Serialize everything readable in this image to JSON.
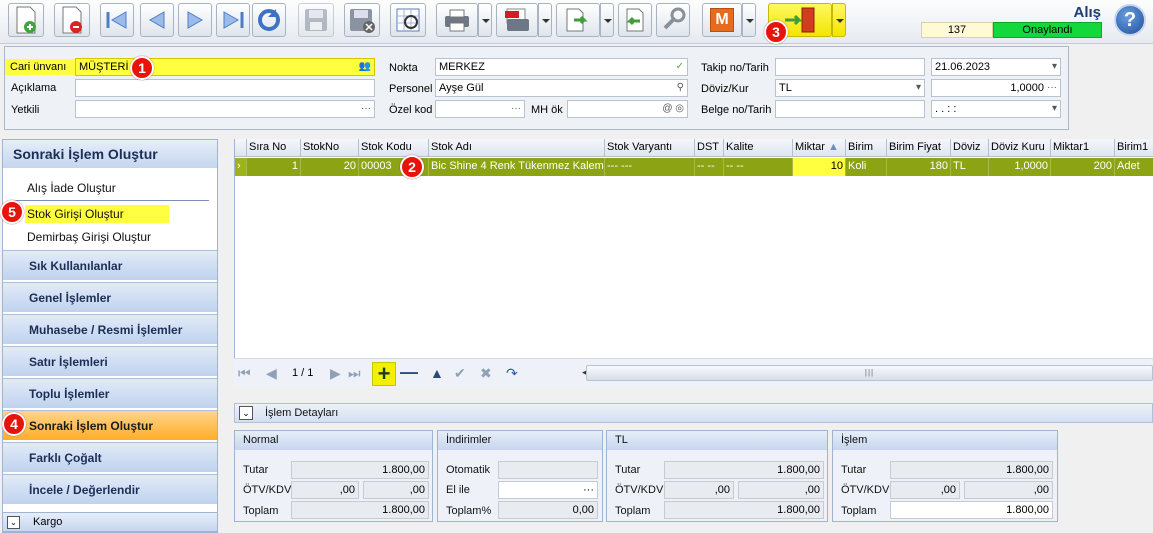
{
  "toolbar": {
    "screen_title": "Alış",
    "doc_number": "137",
    "status": "Onaylandı",
    "m_label": "M"
  },
  "header": {
    "cari_unvani_label": "Cari ünvanı",
    "cari_unvani_value": "MÜŞTERİ 1",
    "aciklama_label": "Açıklama",
    "yetkili_label": "Yetkili",
    "nokta_label": "Nokta",
    "nokta_value": "MERKEZ",
    "personel_label": "Personel",
    "personel_value": "Ayşe Gül",
    "ozel_kod_label": "Özel kod",
    "mh_ok_label": "MH ök",
    "takip_label": "Takip no/Tarih",
    "takip_date": "21.06.2023",
    "doviz_label": "Döviz/Kur",
    "doviz_value": "TL",
    "kur_value": "1,0000",
    "belge_label": "Belge no/Tarih",
    "belge_date": ".  .      :  :"
  },
  "left_panel": {
    "title": "Sonraki İşlem Oluştur",
    "links": [
      "Alış İade Oluştur",
      "Stok Girişi Oluştur",
      "Demirbaş Girişi Oluştur"
    ],
    "sections": [
      "Sık Kullanılanlar",
      "Genel İşlemler",
      "Muhasebe / Resmi İşlemler",
      "Satır İşlemleri",
      "Toplu İşlemler",
      "Sonraki İşlem Oluştur",
      "Farklı Çoğalt",
      "İncele / Değerlendir"
    ],
    "kargo_label": "Kargo"
  },
  "grid": {
    "columns": [
      "Sıra No",
      "StokNo",
      "Stok Kodu",
      "Stok Adı",
      "Stok Varyantı",
      "DST",
      "Kalite",
      "Miktar",
      "Birim",
      "Birim Fiyat",
      "Döviz",
      "Döviz Kuru",
      "Miktar1",
      "Birim1"
    ],
    "row": [
      "1",
      "20",
      "00003",
      "Bic Shine 4 Renk Tükenmez Kalem",
      "--- ---",
      "-- --",
      "-- --",
      "10",
      "Koli",
      "180",
      "TL",
      "1,0000",
      "200",
      "Adet"
    ]
  },
  "nav": {
    "page": "1 / 1"
  },
  "details": {
    "title": "İşlem Detayları",
    "normal": {
      "title": "Normal",
      "tutar_label": "Tutar",
      "tutar": "1.800,00",
      "otv_label": "ÖTV/KDV",
      "otv": ",00",
      "kdv": ",00",
      "toplam_label": "Toplam",
      "toplam": "1.800,00"
    },
    "indirim": {
      "title": "İndirimler",
      "otomatik_label": "Otomatik",
      "elile_label": "El ile",
      "toplam_label": "Toplam%",
      "toplam": "0,00"
    },
    "tl": {
      "title": "TL",
      "tutar_label": "Tutar",
      "tutar": "1.800,00",
      "otv_label": "ÖTV/KDV",
      "otv": ",00",
      "kdv": ",00",
      "toplam_label": "Toplam",
      "toplam": "1.800,00"
    },
    "islem": {
      "title": "İşlem",
      "tutar_label": "Tutar",
      "tutar": "1.800,00",
      "otv_label": "ÖTV/KDV",
      "otv": ",00",
      "kdv": ",00",
      "toplam_label": "Toplam",
      "toplam": "1.800,00"
    }
  },
  "badges": [
    "1",
    "2",
    "3",
    "4",
    "5"
  ]
}
